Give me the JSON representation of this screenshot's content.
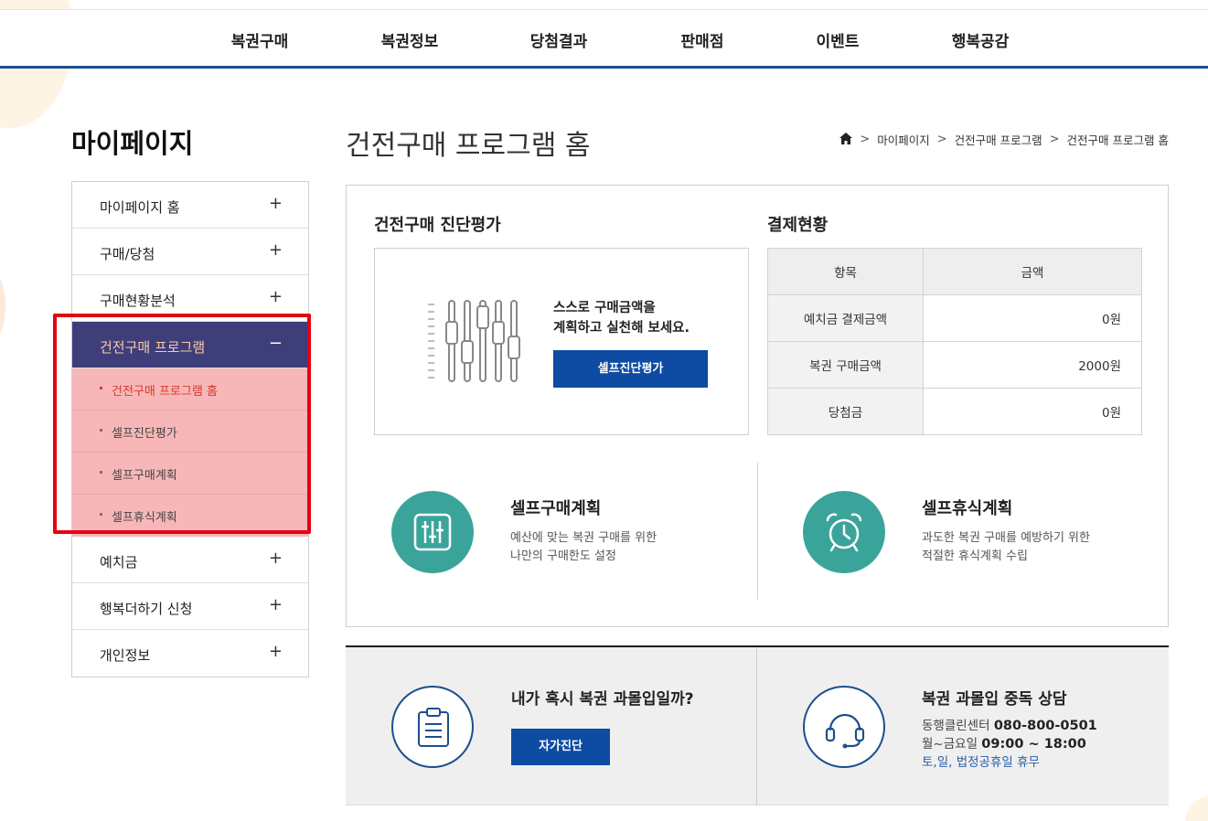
{
  "topnav": [
    "복권구매",
    "복권정보",
    "당첨결과",
    "판매점",
    "이벤트",
    "행복공감"
  ],
  "sidebar": {
    "title": "마이페이지",
    "items": [
      {
        "label": "마이페이지 홈",
        "toggle": "+"
      },
      {
        "label": "구매/당첨",
        "toggle": "+"
      },
      {
        "label": "구매현황분석",
        "toggle": "+"
      },
      {
        "label": "건전구매 프로그램",
        "toggle": "−"
      },
      {
        "label": "예치금",
        "toggle": "+"
      },
      {
        "label": "행복더하기 신청",
        "toggle": "+"
      },
      {
        "label": "개인정보",
        "toggle": "+"
      }
    ],
    "subitems": [
      "건전구매 프로그램 홈",
      "셀프진단평가",
      "셀프구매계획",
      "셀프휴식계획"
    ]
  },
  "page": {
    "title": "건전구매 프로그램 홈",
    "breadcrumb": [
      "마이페이지",
      "건전구매 프로그램",
      "건전구매 프로그램 홈"
    ]
  },
  "diagnosis": {
    "title": "건전구매 진단평가",
    "text_line1": "스스로 구매금액을",
    "text_line2": "계획하고 실천해 보세요.",
    "button": "셀프진단평가"
  },
  "payment": {
    "title": "결제현황",
    "headers": [
      "항목",
      "금액"
    ],
    "rows": [
      {
        "item": "예치금 결제금액",
        "amount": "0원"
      },
      {
        "item": "복권 구매금액",
        "amount": "2000원"
      },
      {
        "item": "당첨금",
        "amount": "0원"
      }
    ]
  },
  "features": [
    {
      "title": "셀프구매계획",
      "desc1": "예산에 맞는 복권 구매를 위한",
      "desc2": "나만의 구매한도 설정",
      "icon": "sliders-icon"
    },
    {
      "title": "셀프휴식계획",
      "desc1": "과도한 복권 구매를 예방하기 위한",
      "desc2": "적절한 휴식계획 수립",
      "icon": "alarm-clock-icon"
    }
  ],
  "bottom": {
    "check_title": "내가 혹시 복권 과몰입일까?",
    "check_button": "자가진단",
    "counsel_title": "복권 과몰입 중독 상담",
    "center_label": "동행클린센터",
    "center_phone": "080-800-0501",
    "hours_label": "월~금요일",
    "hours": "09:00 ~ 18:00",
    "closed": "토,일, 법정공휴일 휴무"
  },
  "colors": {
    "nav_border": "#1c4f8c",
    "button_blue": "#0e4ba3",
    "teal": "#3aa49b",
    "active_menu": "#3e3f7a",
    "highlight_red": "#e60012"
  }
}
